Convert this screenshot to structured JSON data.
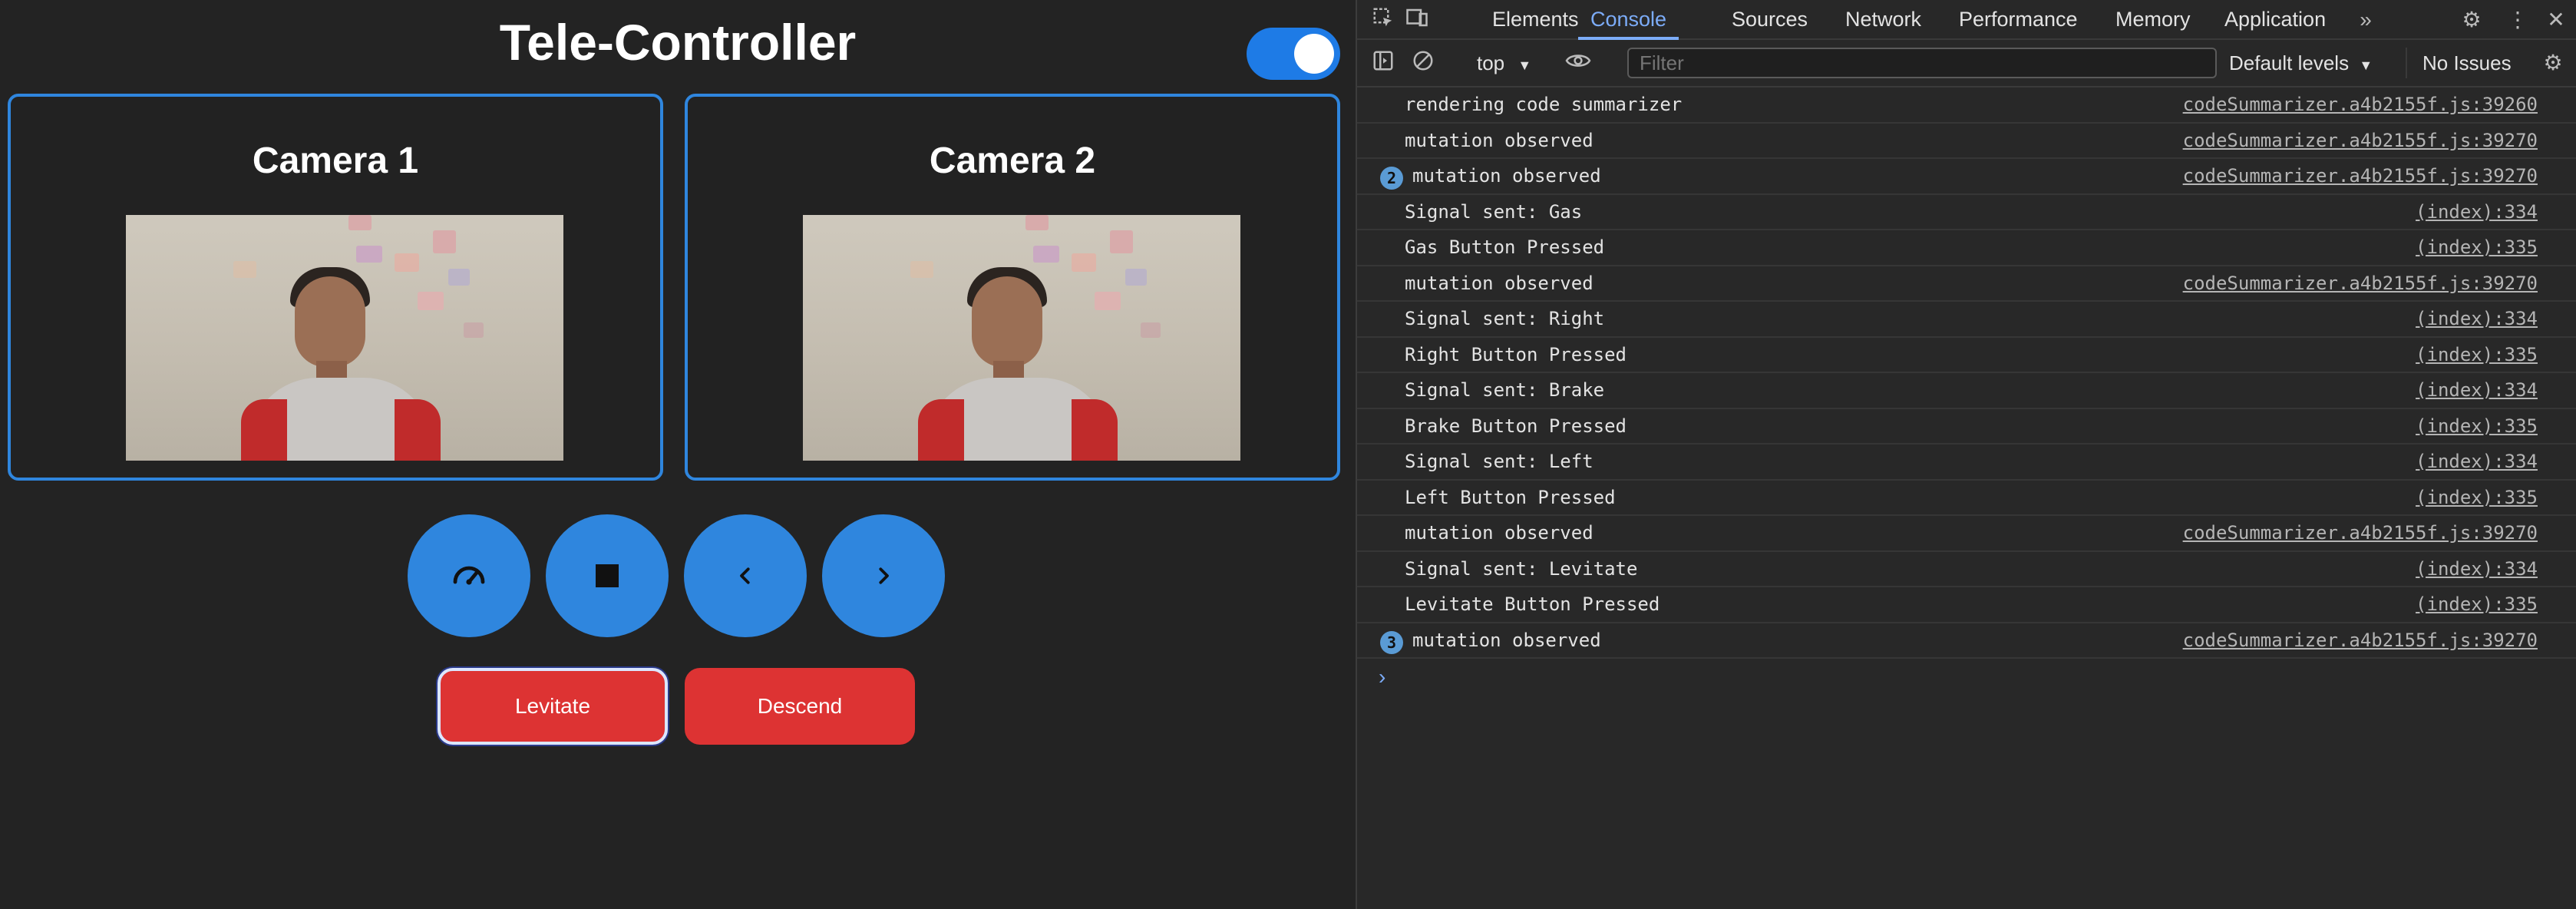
{
  "app": {
    "title": "Tele-Controller",
    "toggle_on": true,
    "cameras": [
      {
        "label": "Camera 1"
      },
      {
        "label": "Camera 2"
      }
    ],
    "controls": [
      {
        "icon": "speedometer-icon",
        "action": "Gas"
      },
      {
        "icon": "stop-icon",
        "action": "Brake"
      },
      {
        "icon": "chevron-left-icon",
        "action": "Left"
      },
      {
        "icon": "chevron-right-icon",
        "action": "Right"
      }
    ],
    "levitate_label": "Levitate",
    "descend_label": "Descend",
    "colors": {
      "accent": "#2f86de",
      "danger": "#dd3333",
      "background": "#232323"
    }
  },
  "devtools": {
    "tabs": [
      "Elements",
      "Console",
      "Sources",
      "Network",
      "Performance",
      "Memory",
      "Application"
    ],
    "active_tab": "Console",
    "context": "top",
    "filter_placeholder": "Filter",
    "levels": "Default levels",
    "issues": "No Issues",
    "console": [
      {
        "msg": "rendering code summarizer",
        "src": "codeSummarizer.a4b2155f.js:39260"
      },
      {
        "msg": "mutation observed",
        "src": "codeSummarizer.a4b2155f.js:39270"
      },
      {
        "count": "2",
        "msg": "mutation observed",
        "src": "codeSummarizer.a4b2155f.js:39270"
      },
      {
        "msg": "Signal sent: Gas",
        "src": "(index):334"
      },
      {
        "msg": "Gas Button Pressed",
        "src": "(index):335"
      },
      {
        "msg": "mutation observed",
        "src": "codeSummarizer.a4b2155f.js:39270"
      },
      {
        "msg": "Signal sent: Right",
        "src": "(index):334"
      },
      {
        "msg": "Right Button Pressed",
        "src": "(index):335"
      },
      {
        "msg": "Signal sent: Brake",
        "src": "(index):334"
      },
      {
        "msg": "Brake Button Pressed",
        "src": "(index):335"
      },
      {
        "msg": "Signal sent: Left",
        "src": "(index):334"
      },
      {
        "msg": "Left Button Pressed",
        "src": "(index):335"
      },
      {
        "msg": "mutation observed",
        "src": "codeSummarizer.a4b2155f.js:39270"
      },
      {
        "msg": "Signal sent: Levitate",
        "src": "(index):334"
      },
      {
        "msg": "Levitate Button Pressed",
        "src": "(index):335"
      },
      {
        "count": "3",
        "msg": "mutation observed",
        "src": "codeSummarizer.a4b2155f.js:39270"
      }
    ]
  }
}
